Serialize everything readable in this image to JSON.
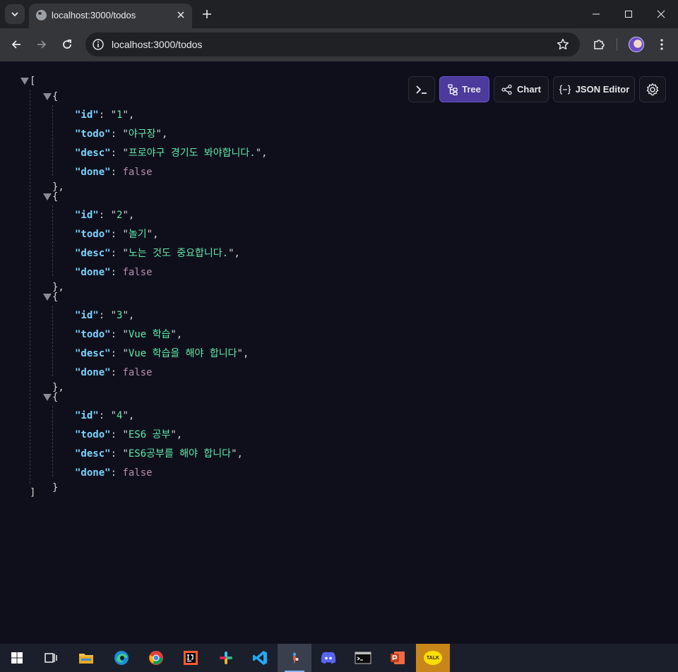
{
  "browser": {
    "tab": {
      "title": "localhost:3000/todos"
    },
    "address": {
      "url": "localhost:3000/todos"
    }
  },
  "viewer": {
    "tools": [
      {
        "label": "",
        "icon": "terminal-icon"
      },
      {
        "label": "Tree",
        "icon": "tree-icon",
        "active": true
      },
      {
        "label": "Chart",
        "icon": "chart-icon"
      },
      {
        "label": "JSON Editor",
        "icon": "braces-icon"
      },
      {
        "label": "",
        "icon": "gear-icon"
      }
    ]
  },
  "todos": [
    {
      "id": "1",
      "todo": "야구장",
      "desc": "프로야구 경기도 봐야합니다.",
      "done": "false"
    },
    {
      "id": "2",
      "todo": "놀기",
      "desc": "노는 것도 중요합니다.",
      "done": "false"
    },
    {
      "id": "3",
      "todo": "Vue 학습",
      "desc": "Vue 학습을 해야 합니다",
      "done": "false"
    },
    {
      "id": "4",
      "todo": "ES6 공부",
      "desc": "ES6공부를 해야 합니다",
      "done": "false"
    }
  ],
  "keys": {
    "id": "\"id\"",
    "todo": "\"todo\"",
    "desc": "\"desc\"",
    "done": "\"done\""
  },
  "punct": {
    "open_array": "[",
    "close_array": "]",
    "open_obj": "{",
    "close_obj_comma": "},",
    "close_obj": "}"
  },
  "taskbar": {
    "apps": [
      "windows-start-icon",
      "task-view-icon",
      "file-explorer-icon",
      "edge-icon",
      "chrome-icon",
      "intellij-icon",
      "slack-icon",
      "vscode-icon",
      "git-tool-icon",
      "discord-icon",
      "terminal-app-icon",
      "powerpoint-icon",
      "kakaotalk-icon"
    ],
    "kakao_label": "TALK"
  },
  "colors": {
    "accent": "#4c3a9c",
    "key": "#7dd3fc",
    "string": "#5eeaa8",
    "boolean": "#b48ead"
  }
}
